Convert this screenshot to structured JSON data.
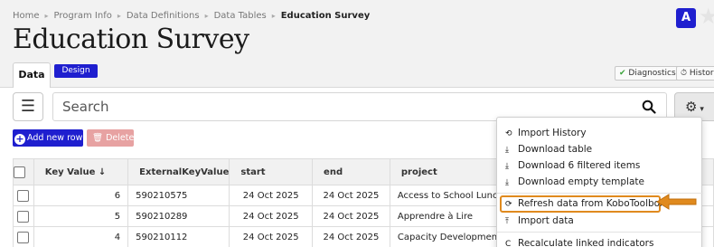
{
  "breadcrumb": [
    "Home",
    "Program Info",
    "Data Definitions",
    "Data Tables",
    "Education Survey"
  ],
  "page": {
    "title": "Education Survey"
  },
  "user": {
    "avatar": "A"
  },
  "tabs": {
    "data": "Data",
    "design": "Design"
  },
  "tools": {
    "diagnostics": "Diagnostics",
    "history": "History"
  },
  "search": {
    "placeholder": "Search"
  },
  "actions": {
    "add_row": "Add new row",
    "delete": "Delete"
  },
  "table": {
    "columns": [
      "Key Value ↓",
      "ExternalKeyValue",
      "start",
      "end",
      "project"
    ],
    "rows": [
      [
        "6",
        "590210575",
        "24 Oct 2025",
        "24 Oct 2025",
        "Access to School Lunches"
      ],
      [
        "5",
        "590210289",
        "24 Oct 2025",
        "24 Oct 2025",
        "Apprendre à Lire"
      ],
      [
        "4",
        "590210112",
        "24 Oct 2025",
        "24 Oct 2025",
        "Capacity Development in R..."
      ]
    ]
  },
  "menu": {
    "items": [
      {
        "icon": "history-icon",
        "label": "Import History"
      },
      {
        "icon": "download-icon",
        "label": "Download table"
      },
      {
        "icon": "download-icon",
        "label": "Download 6 filtered items"
      },
      {
        "icon": "download-icon",
        "label": "Download empty template"
      },
      {
        "icon": "refresh-icon",
        "label": "Refresh data from KoboToolbox"
      },
      {
        "icon": "upload-icon",
        "label": "Import data"
      },
      {
        "icon": "recalculate-icon",
        "label": "Recalculate linked indicators"
      }
    ]
  },
  "colors": {
    "brand": "#1f1fcf",
    "highlight": "#e08a1e",
    "delete": "#e7a2a2"
  }
}
